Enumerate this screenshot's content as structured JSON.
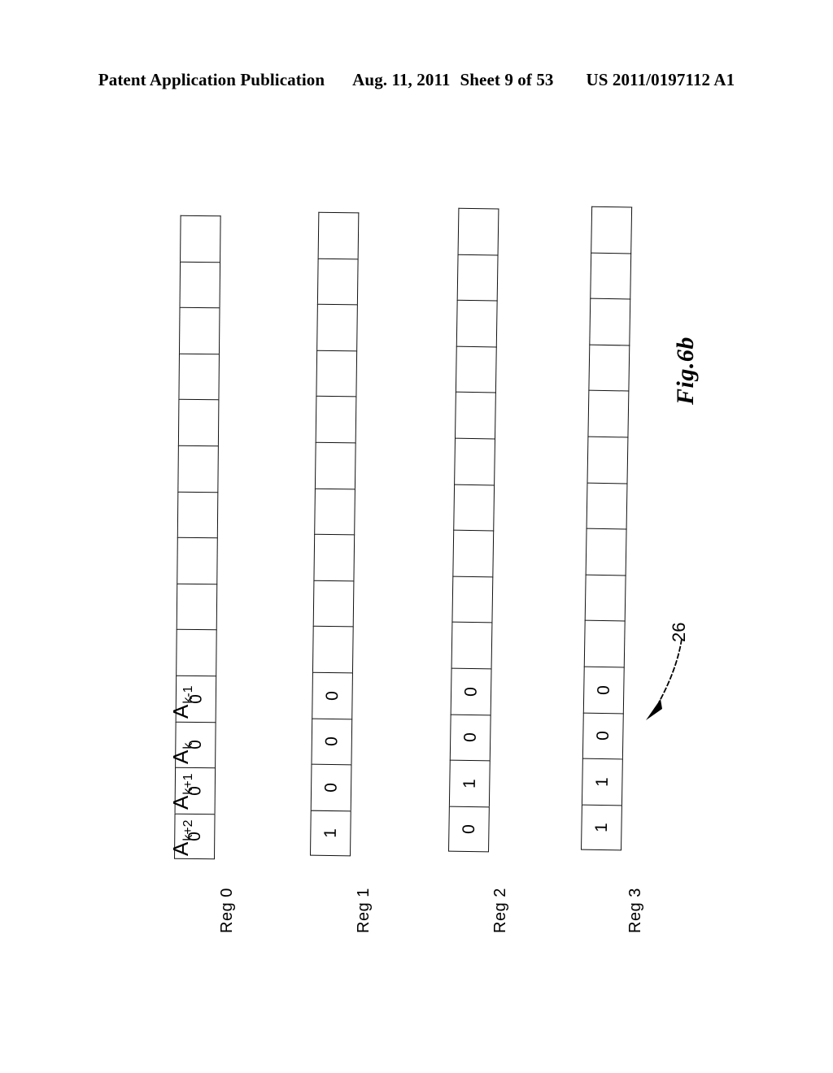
{
  "header": {
    "publication": "Patent Application Publication",
    "date": "Aug. 11, 2011",
    "sheet": "Sheet 9 of 53",
    "patent_number": "US 2011/0197112 A1"
  },
  "figure": {
    "caption": "Fig.6b",
    "reference_numeral": "26",
    "cells_per_register": 14,
    "bit_labels": [
      {
        "base": "A",
        "subscript": "k+2"
      },
      {
        "base": "A",
        "subscript": "k+1"
      },
      {
        "base": "A",
        "subscript": "k"
      },
      {
        "base": "A",
        "subscript": "k-1"
      }
    ],
    "registers": [
      {
        "label": "Reg 0",
        "cells": [
          "",
          "",
          "",
          "",
          "",
          "",
          "",
          "",
          "",
          "",
          "0",
          "0",
          "0",
          "0"
        ]
      },
      {
        "label": "Reg 1",
        "cells": [
          "",
          "",
          "",
          "",
          "",
          "",
          "",
          "",
          "",
          "",
          "0",
          "0",
          "0",
          "1"
        ]
      },
      {
        "label": "Reg 2",
        "cells": [
          "",
          "",
          "",
          "",
          "",
          "",
          "",
          "",
          "",
          "",
          "0",
          "0",
          "1",
          "0"
        ]
      },
      {
        "label": "Reg 3",
        "cells": [
          "",
          "",
          "",
          "",
          "",
          "",
          "",
          "",
          "",
          "",
          "0",
          "0",
          "1",
          "1"
        ]
      }
    ]
  },
  "colors": {
    "ink": "#000000",
    "page": "#ffffff"
  }
}
